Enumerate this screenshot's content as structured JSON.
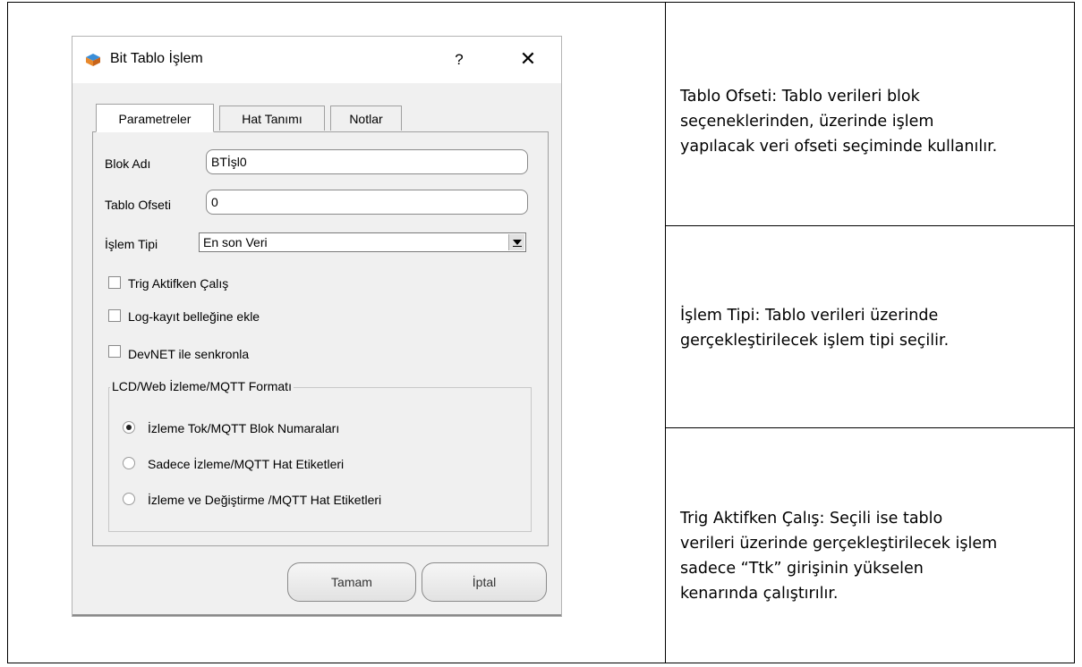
{
  "dialog": {
    "title": "Bit Tablo İşlem",
    "help": "?",
    "close": "✕",
    "tabs": [
      "Parametreler",
      "Hat Tanımı",
      "Notlar"
    ],
    "fields": {
      "block_name_label": "Blok Adı",
      "block_name_value": "BTİşl0",
      "table_offset_label": "Tablo Ofseti",
      "table_offset_value": "0",
      "operation_type_label": "İşlem Tipi",
      "operation_type_value": "En son Veri"
    },
    "checkboxes": [
      "Trig Aktifken Çalış",
      "Log-kayıt belleğine ekle",
      "DevNET ile senkronla"
    ],
    "group": {
      "title": "LCD/Web İzleme/MQTT Formatı",
      "options": [
        "İzleme Tok/MQTT Blok Numaraları",
        "Sadece İzleme/MQTT Hat Etiketleri",
        "İzleme ve Değiştirme /MQTT Hat Etiketleri"
      ],
      "selected_index": 0
    },
    "buttons": {
      "ok": "Tamam",
      "cancel": "İptal"
    }
  },
  "descriptions": [
    "Tablo Ofseti:  Tablo verileri blok\nseçeneklerinden, üzerinde işlem\nyapılacak veri ofseti seçiminde kullanılır.",
    "İşlem Tipi:  Tablo verileri üzerinde\ngerçekleştirilecek işlem tipi seçilir.",
    "Trig Aktifken Çalış:  Seçili ise tablo\nverileri üzerinde gerçekleştirilecek işlem\nsadece “Ttk” girişinin yükselen\nkenarında çalıştırılır."
  ]
}
